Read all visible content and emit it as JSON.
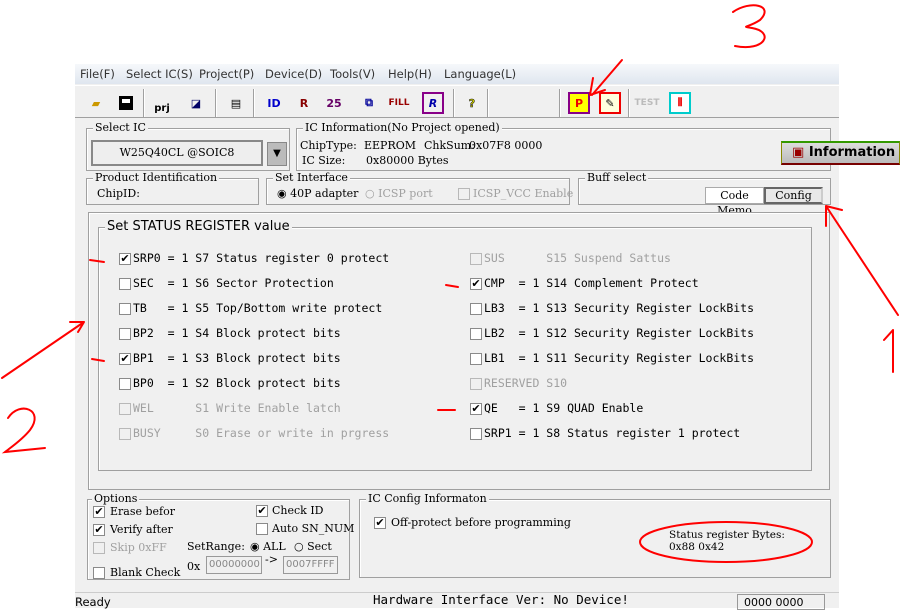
{
  "menu": [
    "File(F)",
    "Select IC(S)",
    "Project(P)",
    "Device(D)",
    "Tools(V)",
    "Help(H)",
    "Language(L)"
  ],
  "toolbar": {
    "icons": [
      "open-folder-icon",
      "save-icon",
      "open-project-icon",
      "save-project-icon",
      "calculator-icon",
      "read-id-icon",
      "read-icon",
      "verify-icon",
      "blank-check-icon",
      "fill-icon",
      "r-chip-icon",
      "help-icon",
      "program-icon",
      "edit-icon",
      "test-icon",
      "chip-icon"
    ],
    "prj_label": "prj",
    "fill_label": "FILL",
    "id_label": "ID",
    "test_label": "TEST"
  },
  "select_ic": {
    "title": "Select IC",
    "value": "W25Q40CL @SOIC8"
  },
  "ic_info": {
    "title": "IC Information(No Project opened)",
    "chiptype_label": "ChipType:",
    "chiptype": "EEPROM",
    "chksum_label": "ChkSum:",
    "chksum": "0x07F8 0000",
    "size_label": "IC Size:",
    "size": "0x80000 Bytes",
    "info_button": "Information"
  },
  "product": {
    "title": "Product Identification",
    "chipid_label": "ChipID:"
  },
  "interface": {
    "title": "Set Interface",
    "options": [
      {
        "label": "40P adapter",
        "selected": true,
        "enabled": true
      },
      {
        "label": "ICSP port",
        "selected": false,
        "enabled": false
      }
    ],
    "icsp_vcc": "ICSP_VCC Enable"
  },
  "buff": {
    "title": "Buff select",
    "tabs": [
      "Code Memo",
      "Config"
    ],
    "active": "Config"
  },
  "status_reg": {
    "title": "Set STATUS REGISTER value",
    "left": [
      {
        "text": "SRP0 = 1 S7 Status register 0 protect",
        "checked": true,
        "enabled": true
      },
      {
        "text": "SEC  = 1 S6 Sector Protection",
        "checked": false,
        "enabled": true
      },
      {
        "text": "TB   = 1 S5 Top/Bottom write protect",
        "checked": false,
        "enabled": true
      },
      {
        "text": "BP2  = 1 S4 Block protect bits",
        "checked": false,
        "enabled": true
      },
      {
        "text": "BP1  = 1 S3 Block protect bits",
        "checked": true,
        "enabled": true
      },
      {
        "text": "BP0  = 1 S2 Block protect bits",
        "checked": false,
        "enabled": true
      },
      {
        "text": "WEL      S1 Write Enable latch",
        "checked": false,
        "enabled": false
      },
      {
        "text": "BUSY     S0 Erase or write in prgress",
        "checked": false,
        "enabled": false
      }
    ],
    "right": [
      {
        "text": "SUS      S15 Suspend Sattus",
        "checked": false,
        "enabled": false
      },
      {
        "text": "CMP  = 1 S14 Complement Protect",
        "checked": true,
        "enabled": true
      },
      {
        "text": "LB3  = 1 S13 Security Register LockBits",
        "checked": false,
        "enabled": true
      },
      {
        "text": "LB2  = 1 S12 Security Register LockBits",
        "checked": false,
        "enabled": true
      },
      {
        "text": "LB1  = 1 S11 Security Register LockBits",
        "checked": false,
        "enabled": true
      },
      {
        "text": "RESERVED S10",
        "checked": false,
        "enabled": false
      },
      {
        "text": "QE   = 1 S9 QUAD Enable",
        "checked": true,
        "enabled": true
      },
      {
        "text": "SRP1 = 1 S8 Status register 1 protect",
        "checked": false,
        "enabled": true
      }
    ]
  },
  "options": {
    "title": "Options",
    "erase": "Erase befor",
    "verify": "Verify after",
    "skip": "Skip 0xFF",
    "blank": "Blank Check",
    "check_id": "Check ID",
    "auto_sn": "Auto SN_NUM",
    "setrange": "SetRange:",
    "all": "ALL",
    "sect": "Sect",
    "ox": "0x",
    "from": "00000000",
    "arrow": "->",
    "to": "0007FFFF"
  },
  "ic_config": {
    "title": "IC Config Informaton",
    "off_protect": "Off-protect before programming",
    "status_bytes_label": "Status register Bytes:",
    "status_bytes": "0x88 0x42"
  },
  "statusbar": {
    "left": "Ready",
    "center": "Hardware Interface Ver: No Device!",
    "right": "0000 0000"
  },
  "annotations": [
    "1",
    "2",
    "3"
  ],
  "colors": {
    "annotation": "#ff0000",
    "window_bg": "#f0f0f0"
  }
}
